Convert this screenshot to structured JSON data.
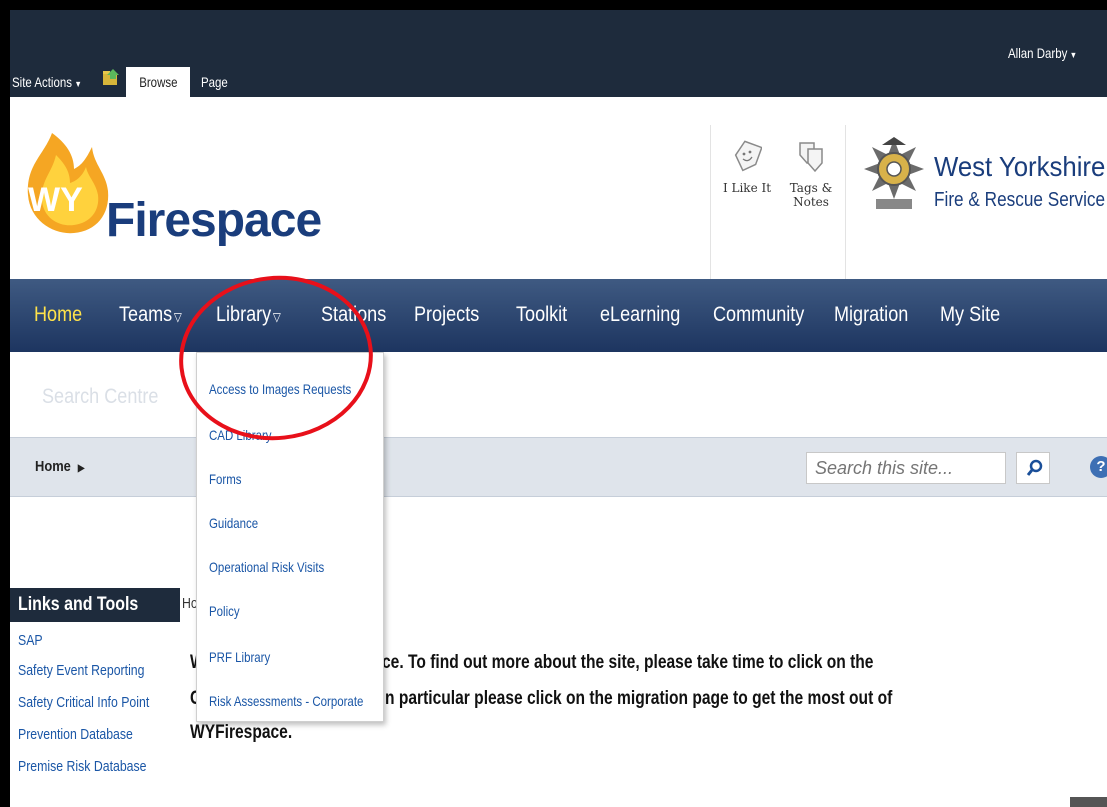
{
  "ribbon": {
    "site_actions": "Site Actions",
    "tabs": [
      "Browse",
      "Page"
    ],
    "user": "Allan Darby"
  },
  "header": {
    "logo_text": "Firespace",
    "logo_badge": "WY",
    "social": {
      "like": "I Like It",
      "tags_line1": "Tags &",
      "tags_line2": "Notes"
    },
    "org_name_line1": "West Yorkshire",
    "org_name_line2": "Fire & Rescue Service"
  },
  "topnav": {
    "items": [
      "Home",
      "Teams",
      "Library",
      "Stations",
      "Projects",
      "Toolkit",
      "eLearning",
      "Community",
      "Migration",
      "My Site"
    ]
  },
  "search_centre": "Search Centre",
  "breadcrumb": {
    "home": "Home",
    "search_placeholder": "Search this site..."
  },
  "left_nav": {
    "title": "Links and Tools",
    "links": [
      "SAP",
      "Safety Event Reporting",
      "Safety Critical Info Point",
      "Prevention Database",
      "Premise Risk Database"
    ]
  },
  "library_menu": {
    "items": [
      "Access to Images Requests",
      "CAD Library",
      "Forms",
      "Guidance",
      "Operational Risk Visits",
      "Policy",
      "PRF Library",
      "Risk Assessments - Corporate"
    ]
  },
  "content": {
    "crumb": "Ho",
    "line1_lead": "W",
    "line1": "ce.  To find out more about the site, please take time to click on the",
    "line2_lead": "C",
    "line2": "n particular please click on the migration page to get the most out of",
    "line3": "WYFirespace."
  },
  "colors": {
    "ribbon": "#1e2b3c",
    "nav_active": "#ffe24a",
    "link": "#1a56a6",
    "annotation": "#e8101a"
  }
}
